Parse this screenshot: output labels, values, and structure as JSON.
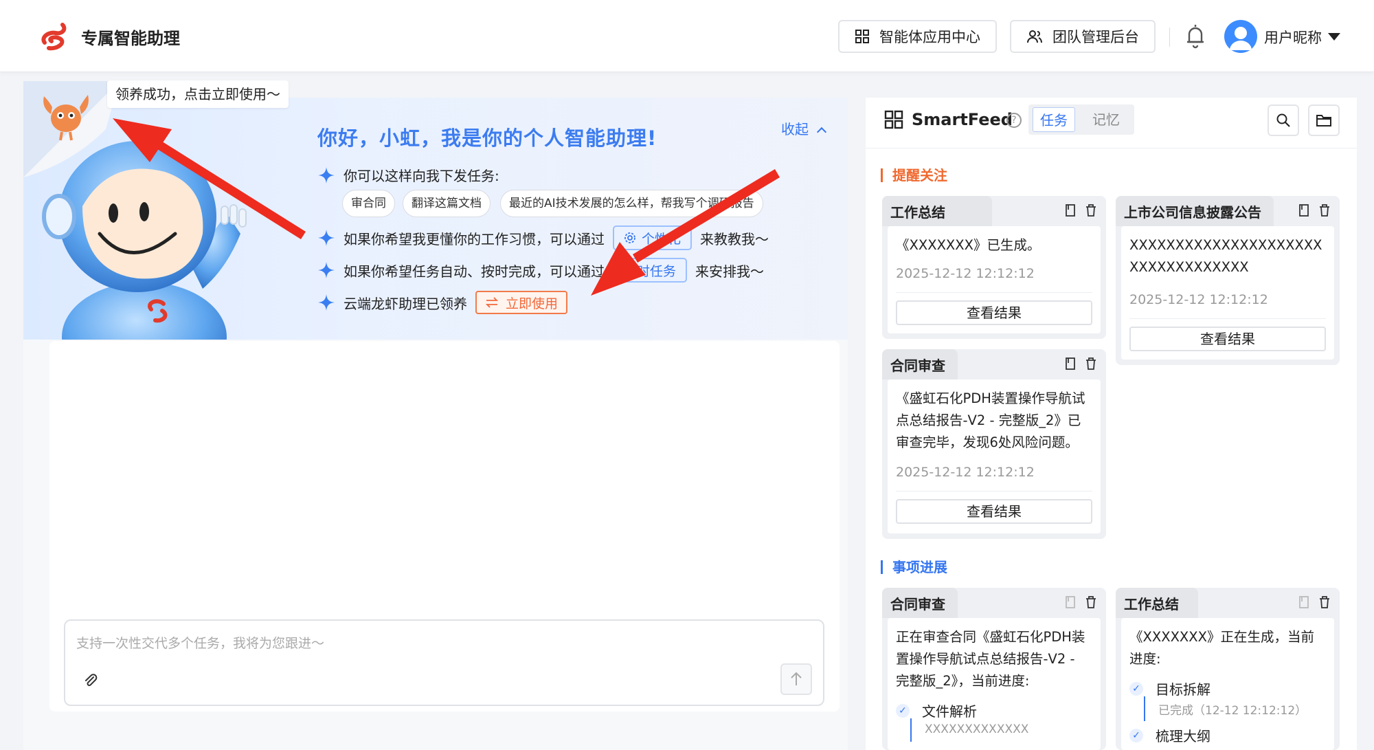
{
  "header": {
    "brand": "专属智能助理",
    "btn_agent_center": "智能体应用中心",
    "btn_team_admin": "团队管理后台",
    "user_name": "用户昵称"
  },
  "toast": "领养成功，点击立即使用～",
  "hero": {
    "greeting": "你好，小虹，我是你的个人智能助理!",
    "collapse": "收起",
    "line1": "你可以这样向我下发任务:",
    "chips": [
      "审合同",
      "翻译这篇文档",
      "最近的AI技术发展的怎么样，帮我写个调研报告"
    ],
    "line2_pre": "如果你希望我更懂你的工作习惯，可以通过",
    "line2_btn": "个性化",
    "line2_post": "来教教我～",
    "line3_pre": "如果你希望任务自动、按时完成，可以通过",
    "line3_btn": "定时任务",
    "line3_post": "来安排我～",
    "line4_pre": "云端龙虾助理已领养",
    "line4_btn": "立即使用"
  },
  "input": {
    "placeholder": "支持一次性交代多个任务，我将为您跟进～"
  },
  "smartfeed": {
    "title": "SmartFeed",
    "tab_task": "任务",
    "tab_memory": "记忆",
    "section_reminder": "提醒关注",
    "section_progress": "事项进展",
    "cards": [
      {
        "title": "工作总结",
        "text": "《XXXXXXX》已生成。",
        "time": "2025-12-12 12:12:12",
        "button": "查看结果"
      },
      {
        "title": "上市公司信息披露公告",
        "text": "XXXXXXXXXXXXXXXXXXXXXXXXXXXXXXXXXX",
        "time": "2025-12-12 12:12:12",
        "button": "查看结果"
      },
      {
        "title": "合同审查",
        "text": "《盛虹石化PDH装置操作导航试点总结报告-V2 - 完整版_2》已审查完毕，发现6处风险问题。",
        "time": "2025-12-12 12:12:12",
        "button": "查看结果"
      }
    ],
    "progress_cards": [
      {
        "title": "合同审查",
        "text": "正在审查合同《盛虹石化PDH装置操作导航试点总结报告-V2 - 完整版_2》，当前进度:",
        "step1": "文件解析",
        "step1_sub": "XXXXXXXXXXXXX"
      },
      {
        "title": "工作总结",
        "text": "《XXXXXXX》正在生成，当前进度:",
        "step1": "目标拆解",
        "step1_sub": "已完成（12-12 12:12:12）",
        "step2": "梳理大纲"
      }
    ]
  },
  "colors": {
    "accent": "#3576f0",
    "orange": "#f0682e",
    "arrow": "#ee2b1f"
  }
}
